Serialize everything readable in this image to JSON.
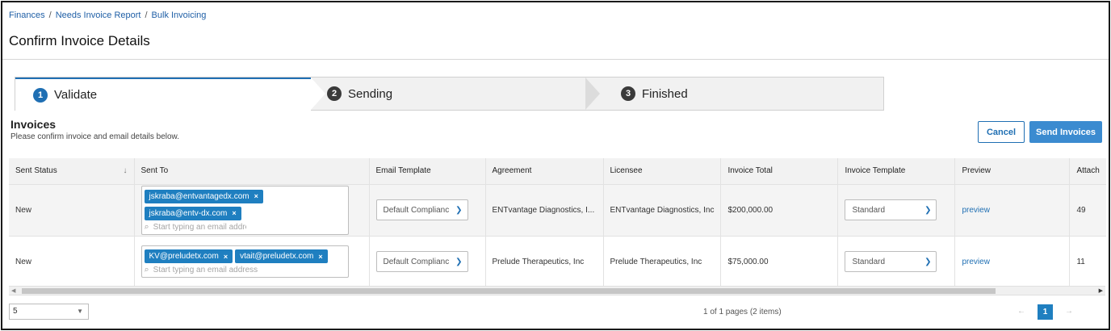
{
  "breadcrumb": [
    "Finances",
    "Needs Invoice Report",
    "Bulk Invoicing"
  ],
  "breadcrumb_sep": "/",
  "page_title": "Confirm Invoice Details",
  "steps": [
    {
      "num": "1",
      "label": "Validate",
      "active": true
    },
    {
      "num": "2",
      "label": "Sending",
      "active": false
    },
    {
      "num": "3",
      "label": "Finished",
      "active": false
    }
  ],
  "section": {
    "title": "Invoices",
    "subtitle": "Please confirm invoice and email details below."
  },
  "buttons": {
    "cancel": "Cancel",
    "send": "Send Invoices"
  },
  "table": {
    "columns": [
      "Sent Status",
      "Sent To",
      "Email Template",
      "Agreement",
      "Licensee",
      "Invoice Total",
      "Invoice Template",
      "Preview",
      "Attach"
    ],
    "sort_icon": "↓",
    "rows": [
      {
        "status": "New",
        "emails": [
          "jskraba@entvantagedx.com",
          "jskraba@entv-dx.com"
        ],
        "email_placeholder": "Start typing an email address",
        "email_template": "Default Complianc",
        "agreement": "ENTvantage Diagnostics, I...",
        "licensee": "ENTvantage Diagnostics, Inc",
        "total": "$200,000.00",
        "invoice_template": "Standard",
        "preview": "preview",
        "attach": "49"
      },
      {
        "status": "New",
        "emails": [
          "KV@preludetx.com",
          "vtait@preludetx.com"
        ],
        "email_placeholder": "Start typing an email address",
        "email_template": "Default Complianc",
        "agreement": "Prelude Therapeutics, Inc",
        "licensee": "Prelude Therapeutics, Inc",
        "total": "$75,000.00",
        "invoice_template": "Standard",
        "preview": "preview",
        "attach": "11"
      }
    ]
  },
  "chip_remove": "×",
  "pager": {
    "page_size": "5",
    "info": "1 of 1 pages (2 items)",
    "current": "1",
    "prev": "←",
    "next": "→"
  },
  "colors": {
    "accent": "#1f6fb3",
    "chip": "#1f7fc0",
    "send_button": "#3b8bd0"
  }
}
